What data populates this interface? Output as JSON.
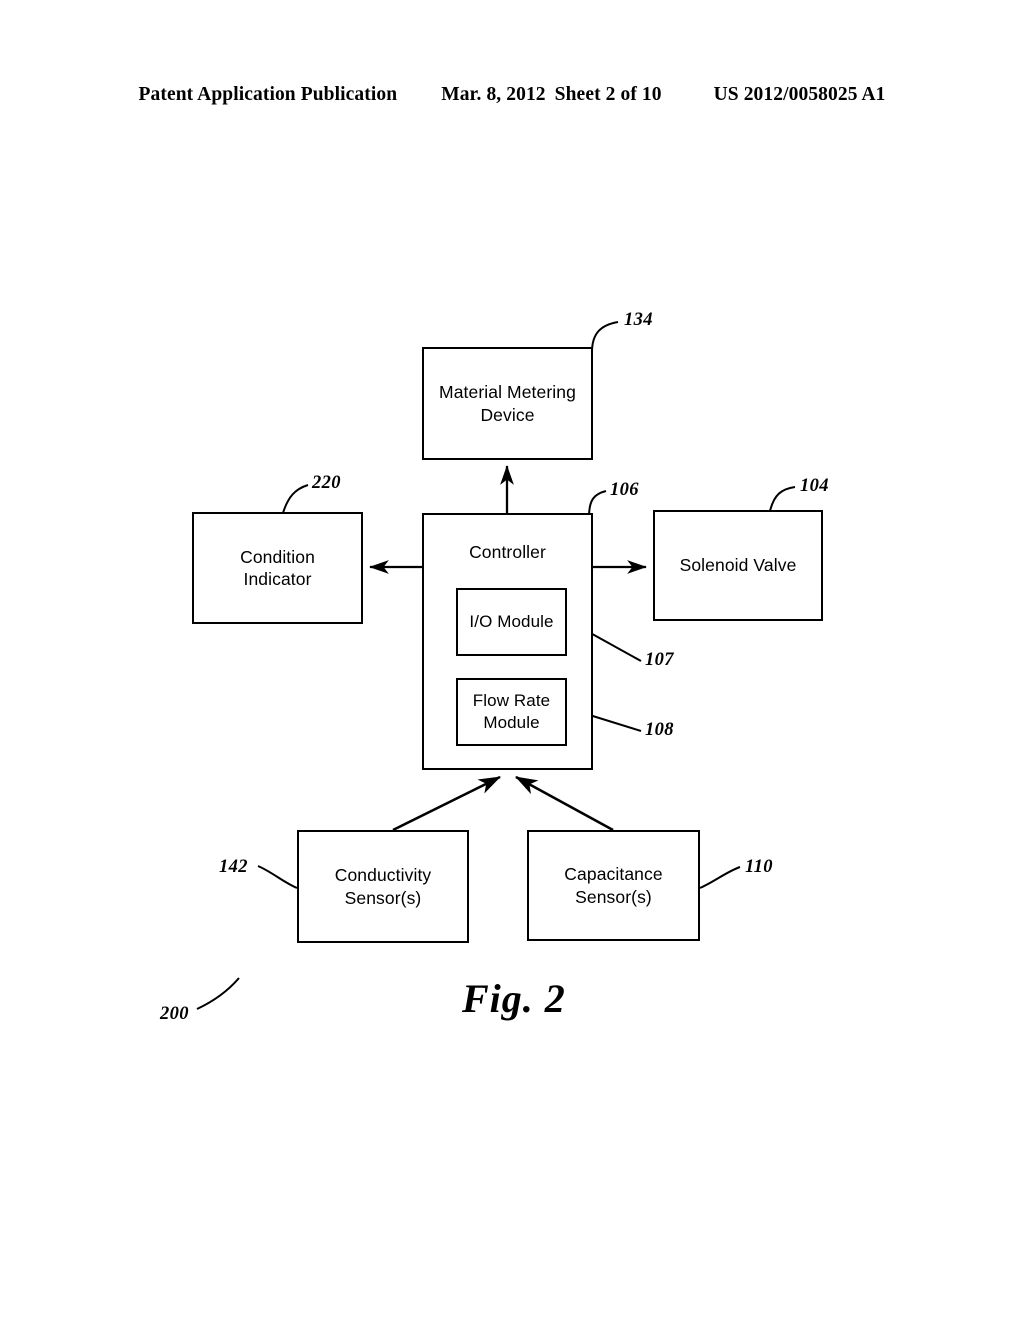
{
  "header": {
    "publication": "Patent Application Publication",
    "date": "Mar. 8, 2012",
    "sheet": "Sheet 2 of 10",
    "number": "US 2012/0058025 A1"
  },
  "figure": {
    "caption": "Fig. 2",
    "system_ref": "200"
  },
  "nodes": [
    {
      "id": "metering",
      "label": "Material Metering Device",
      "ref": "134"
    },
    {
      "id": "controller",
      "label": "Controller",
      "ref": "106"
    },
    {
      "id": "io",
      "label": "I/O Module",
      "ref": "107"
    },
    {
      "id": "flowrate",
      "label": "Flow Rate Module",
      "ref": "108"
    },
    {
      "id": "condition",
      "label": "Condition Indicator",
      "ref": "220"
    },
    {
      "id": "solenoid",
      "label": "Solenoid Valve",
      "ref": "104"
    },
    {
      "id": "conduct",
      "label": "Conductivity Sensor(s)",
      "ref": "142"
    },
    {
      "id": "capacit",
      "label": "Capacitance Sensor(s)",
      "ref": "110"
    }
  ],
  "labels": {
    "metering_line1": "Material Metering",
    "metering_line2": "Device",
    "controller": "Controller",
    "io_module": "I/O Module",
    "flowrate_line1": "Flow Rate",
    "flowrate_line2": "Module",
    "condition_line1": "Condition",
    "condition_line2": "Indicator",
    "solenoid": "Solenoid Valve",
    "conduct_line1": "Conductivity",
    "conduct_line2": "Sensor(s)",
    "capacit_line1": "Capacitance",
    "capacit_line2": "Sensor(s)"
  },
  "refs": {
    "metering": "134",
    "controller": "106",
    "io": "107",
    "flowrate": "108",
    "condition": "220",
    "solenoid": "104",
    "conduct": "142",
    "capacit": "110",
    "system": "200"
  },
  "connections": [
    {
      "from": "controller",
      "to": "metering",
      "arrow": "up"
    },
    {
      "from": "controller",
      "to": "condition",
      "arrow": "left"
    },
    {
      "from": "controller",
      "to": "solenoid",
      "arrow": "right"
    },
    {
      "from": "conduct",
      "to": "controller",
      "arrow": "up-right"
    },
    {
      "from": "capacit",
      "to": "controller",
      "arrow": "up-left"
    }
  ],
  "colors": {
    "ink": "#000000",
    "page": "#ffffff"
  }
}
